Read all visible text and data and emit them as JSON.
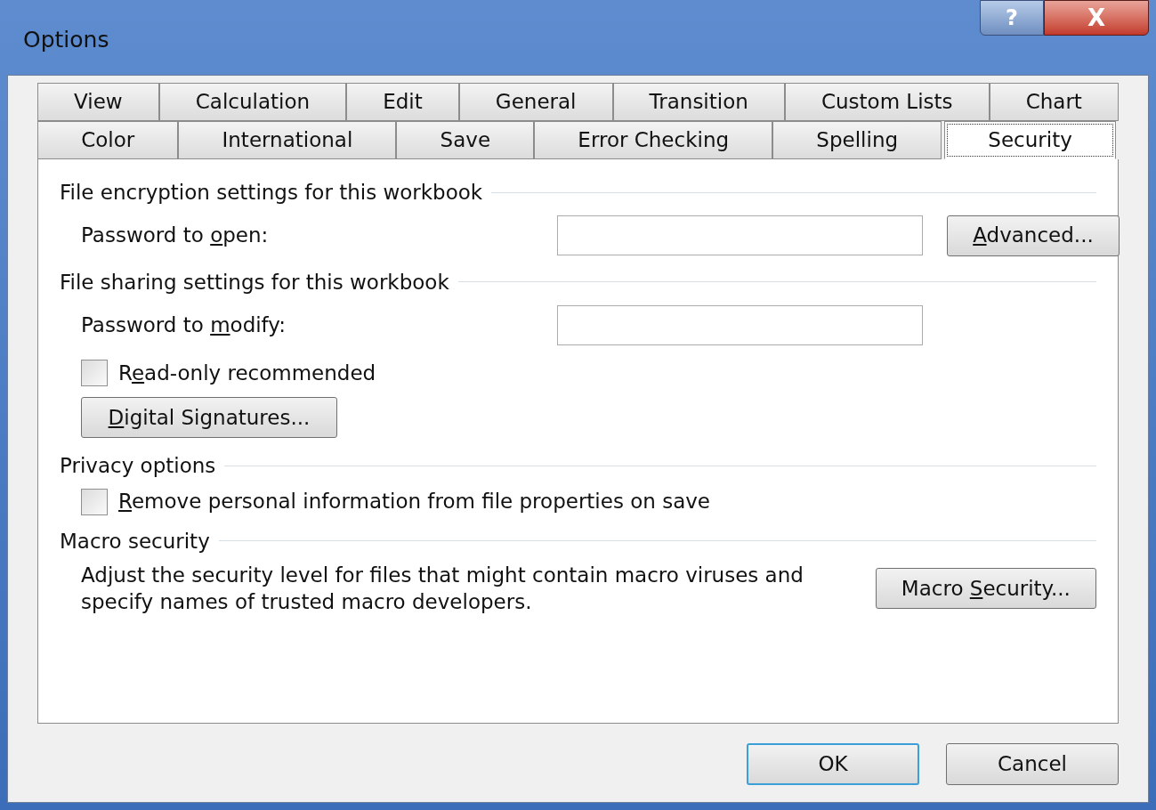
{
  "window": {
    "title": "Options",
    "help_button": "?",
    "close_button": "X"
  },
  "tab_rows": [
    [
      {
        "label": "View",
        "selected": false
      },
      {
        "label": "Calculation",
        "selected": false
      },
      {
        "label": "Edit",
        "selected": false
      },
      {
        "label": "General",
        "selected": false
      },
      {
        "label": "Transition",
        "selected": false
      },
      {
        "label": "Custom Lists",
        "selected": false
      },
      {
        "label": "Chart",
        "selected": false
      }
    ],
    [
      {
        "label": "Color",
        "selected": false
      },
      {
        "label": "International",
        "selected": false
      },
      {
        "label": "Save",
        "selected": false
      },
      {
        "label": "Error Checking",
        "selected": false
      },
      {
        "label": "Spelling",
        "selected": false
      },
      {
        "label": "Security",
        "selected": true
      }
    ]
  ],
  "sections": [
    {
      "heading": "File encryption settings for this workbook",
      "items": [
        {
          "kind": "password",
          "label": {
            "before": "Password to ",
            "key": "o",
            "after": "pen:"
          },
          "button": {
            "key": "A",
            "after": "dvanced..."
          }
        }
      ]
    },
    {
      "heading": "File sharing settings for this workbook",
      "items": [
        {
          "kind": "password",
          "label": {
            "before": "Password to ",
            "key": "m",
            "after": "odify:"
          }
        },
        {
          "kind": "checkbox",
          "label": {
            "before": "R",
            "key": "e",
            "after": "ad-only recommended"
          },
          "checked": false
        },
        {
          "kind": "button",
          "button": {
            "key": "D",
            "after": "igital Signatures..."
          }
        }
      ]
    },
    {
      "heading": "Privacy options",
      "items": [
        {
          "kind": "checkbox",
          "label": {
            "key": "R",
            "after": "emove personal information from file properties on save"
          },
          "checked": false
        }
      ]
    },
    {
      "heading": "Macro security",
      "items": [
        {
          "kind": "description",
          "text": "Adjust the security level for files that might contain macro viruses and specify names of trusted macro developers.",
          "button": {
            "before": "Macro ",
            "key": "S",
            "after": "ecurity..."
          }
        }
      ]
    }
  ],
  "footer_buttons": [
    {
      "label": "OK",
      "default": true
    },
    {
      "label": "Cancel",
      "default": false
    }
  ]
}
